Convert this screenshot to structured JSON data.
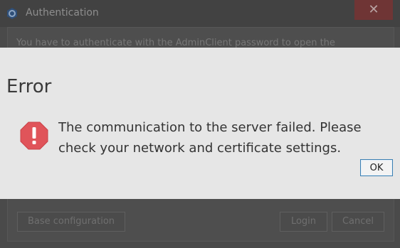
{
  "auth_window": {
    "title": "Authentication",
    "close_glyph": "✕",
    "message": "You have to authenticate with the AdminClient password to open the",
    "buttons": {
      "base_configuration": "Base configuration",
      "login": "Login",
      "cancel": "Cancel"
    }
  },
  "error_dialog": {
    "title": "Error",
    "icon": "error-octagon-icon",
    "message": "The communication to the server failed. Please check your network and certificate settings.",
    "ok_label": "OK"
  },
  "colors": {
    "error_icon": "#e0545a",
    "ok_border": "#3c7fb1",
    "dialog_bg": "#e6e6e6"
  }
}
